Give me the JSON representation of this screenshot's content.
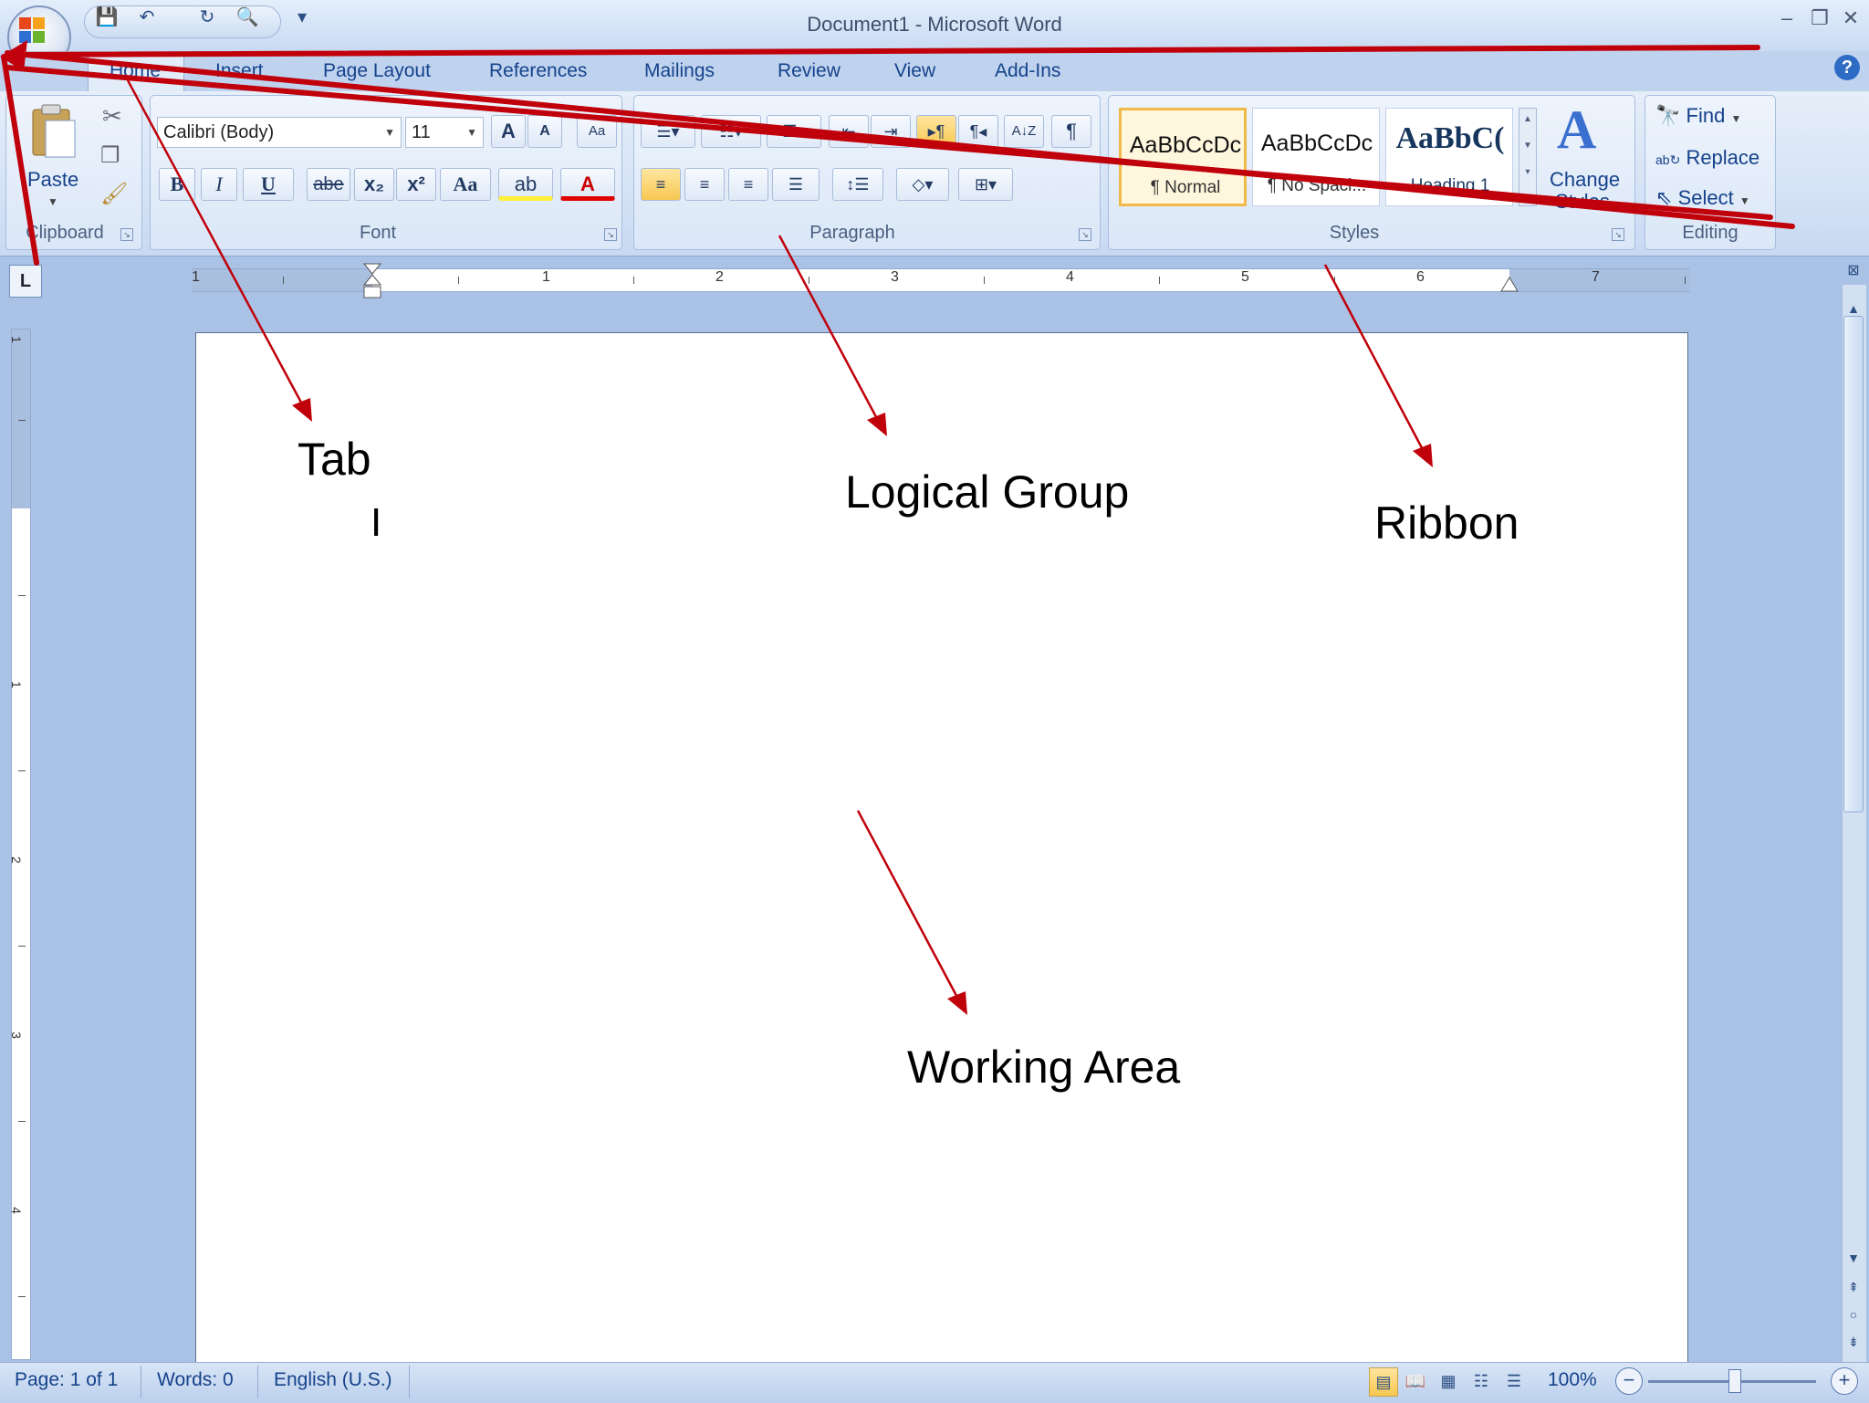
{
  "window": {
    "title": "Document1 - Microsoft Word",
    "minimize": "–",
    "restore": "❐",
    "close": "✕",
    "help": "?"
  },
  "qat": {
    "save": "💾",
    "undo": "↶",
    "redo": "↻",
    "print_preview": "🔍",
    "customize": "▾"
  },
  "tabs": [
    "Home",
    "Insert",
    "Page Layout",
    "References",
    "Mailings",
    "Review",
    "View",
    "Add-Ins"
  ],
  "clipboard": {
    "group_label": "Clipboard",
    "paste_label": "Paste",
    "launcher": "↘"
  },
  "font": {
    "group_label": "Font",
    "font_name": "Calibri (Body)",
    "font_size": "11",
    "grow": "A",
    "shrink": "A",
    "clear_formatting": "Aa",
    "bold": "B",
    "italic": "I",
    "underline": "U",
    "strikethrough": "abe",
    "subscript": "x₂",
    "superscript": "x²",
    "change_case": "Aa",
    "highlight": "ab",
    "font_color": "A"
  },
  "paragraph": {
    "group_label": "Paragraph",
    "show_hide": "¶",
    "sort": "A↓Z"
  },
  "styles": {
    "group_label": "Styles",
    "items": [
      {
        "sample": "AaBbCcDc",
        "name": "¶ Normal"
      },
      {
        "sample": "AaBbCcDc",
        "name": "¶ No Spaci..."
      },
      {
        "sample": "AaBbC(",
        "name": "Heading 1"
      }
    ],
    "change_styles_line1": "Change",
    "change_styles_line2": "Styles"
  },
  "editing": {
    "group_label": "Editing",
    "find": "Find",
    "replace": "Replace",
    "select": "Select"
  },
  "ruler": {
    "tab_selector": "L",
    "numbers": [
      "1",
      "1",
      "2",
      "3",
      "4",
      "5",
      "6",
      "7"
    ]
  },
  "vruler": {
    "numbers": [
      "1",
      "1",
      "2",
      "3",
      "4"
    ]
  },
  "status": {
    "page": "Page: 1 of 1",
    "words": "Words: 0",
    "language": "English (U.S.)",
    "zoom": "100%",
    "zoom_out": "−",
    "zoom_in": "+"
  },
  "annotations": {
    "tab": "Tab",
    "logical_group": "Logical Group",
    "ribbon": "Ribbon",
    "working_area": "Working Area",
    "cursor": "I"
  },
  "colors": {
    "arrow": "#c0000a",
    "accent": "#15428b",
    "highlight_orange": "#f7c850"
  }
}
